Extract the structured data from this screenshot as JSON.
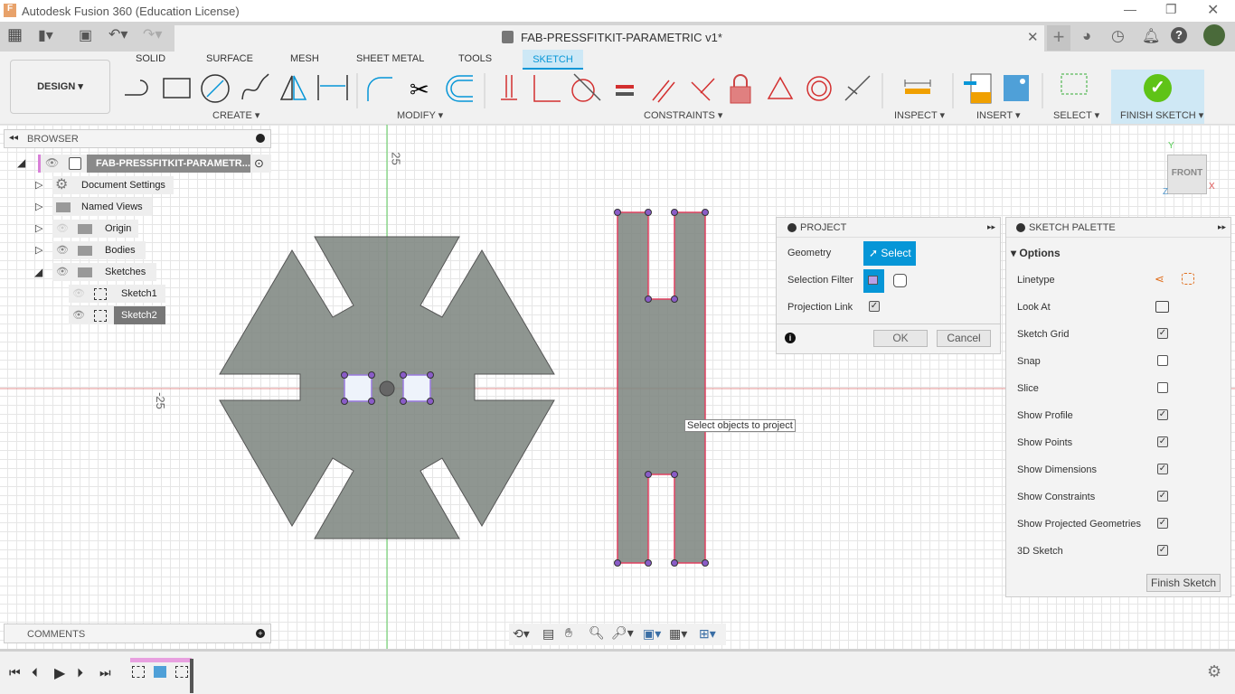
{
  "window": {
    "title": "Autodesk Fusion 360 (Education License)",
    "document_tab": "FAB-PRESSFITKIT-PARAMETRIC v1*"
  },
  "ribbon": {
    "workspace": "DESIGN",
    "tabs": [
      "SOLID",
      "SURFACE",
      "MESH",
      "SHEET METAL",
      "TOOLS",
      "SKETCH"
    ],
    "active_tab": "SKETCH",
    "groups": [
      "CREATE",
      "MODIFY",
      "CONSTRAINTS",
      "INSPECT",
      "INSERT",
      "SELECT",
      "FINISH SKETCH"
    ]
  },
  "browser": {
    "title": "BROWSER",
    "root": "FAB-PRESSFITKIT-PARAMETR...",
    "items": [
      "Document Settings",
      "Named Views",
      "Origin",
      "Bodies",
      "Sketches",
      "Sketch1",
      "Sketch2"
    ]
  },
  "comments": {
    "title": "COMMENTS"
  },
  "canvas": {
    "axis_label_top": "25",
    "axis_label_left": "-25",
    "tooltip": "Select objects to project",
    "viewcube": "FRONT",
    "axis_y": "Y",
    "axis_x": "X",
    "axis_z": "Z"
  },
  "project": {
    "title": "PROJECT",
    "geometry_label": "Geometry",
    "select_label": "Select",
    "filter_label": "Selection Filter",
    "link_label": "Projection Link",
    "link_checked": true,
    "ok": "OK",
    "cancel": "Cancel"
  },
  "palette": {
    "title": "SKETCH PALETTE",
    "section": "Options",
    "options": [
      {
        "label": "Linetype"
      },
      {
        "label": "Look At"
      },
      {
        "label": "Sketch Grid",
        "checked": true
      },
      {
        "label": "Snap",
        "checked": false
      },
      {
        "label": "Slice",
        "checked": false
      },
      {
        "label": "Show Profile",
        "checked": true
      },
      {
        "label": "Show Points",
        "checked": true
      },
      {
        "label": "Show Dimensions",
        "checked": true
      },
      {
        "label": "Show Constraints",
        "checked": true
      },
      {
        "label": "Show Projected Geometries",
        "checked": true
      },
      {
        "label": "3D Sketch",
        "checked": true
      }
    ],
    "finish": "Finish Sketch"
  },
  "colors": {
    "accent": "#0696d7",
    "profile": "#8b918e",
    "finish_green": "#5fc317",
    "constraint_red": "#d32f2f"
  }
}
